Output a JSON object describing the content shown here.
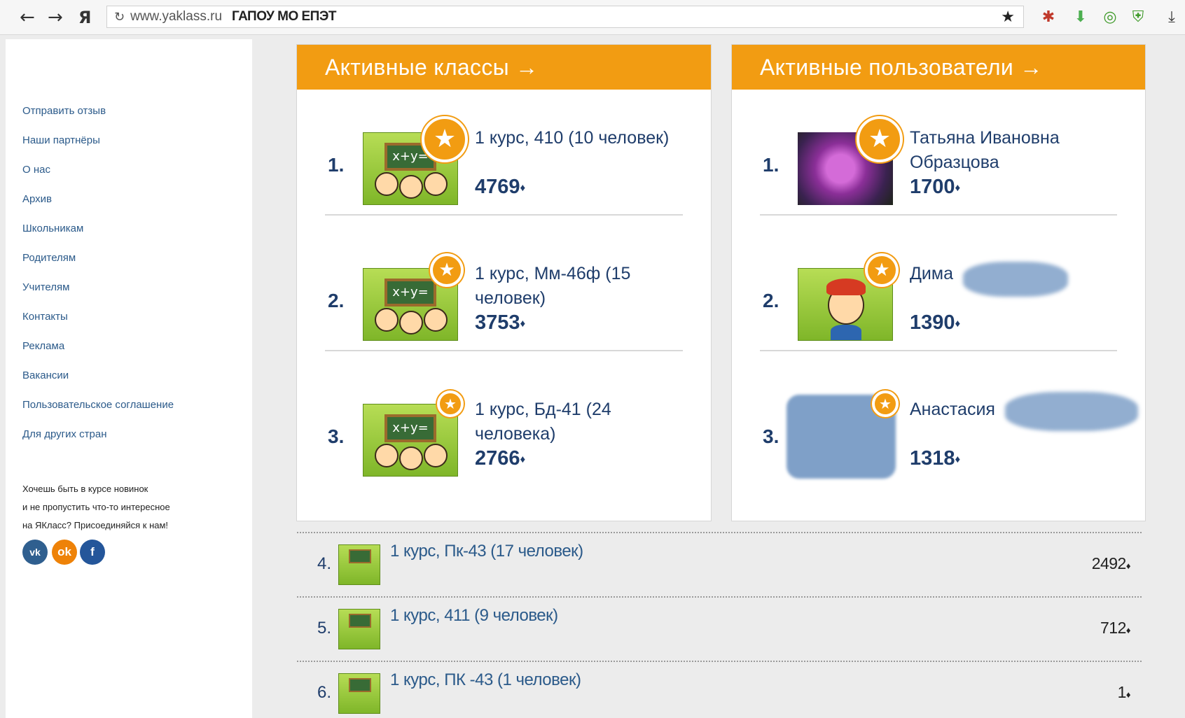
{
  "browser": {
    "back": "←",
    "forward": "→",
    "home": "Я",
    "url": "www.yaklass.ru",
    "page_title": "ГАПОУ МО ЕПЭТ"
  },
  "sidebar": {
    "links": [
      "Отправить отзыв",
      "Наши партнёры",
      "О нас",
      "Архив",
      "Школьникам",
      "Родителям",
      "Учителям",
      "Контакты",
      "Реклама",
      "Вакансии",
      "Пользовательское соглашение",
      "Для других стран"
    ],
    "promo": [
      "Хочешь быть в курсе новинок",
      "и не пропустить что-то интересное",
      "на ЯКласс? Присоединяйся к нам!"
    ],
    "social": [
      "vk",
      "ok",
      "f"
    ]
  },
  "classes_panel": {
    "title": "Активные классы →",
    "board_text": "x+y=",
    "entries": [
      {
        "rank": "1.",
        "name": "1 курс, 410 (10 человек)",
        "score": "4769"
      },
      {
        "rank": "2.",
        "name": "1 курс, Мм-46ф (15 человек)",
        "score": "3753"
      },
      {
        "rank": "3.",
        "name": "1 курс, Бд-41 (24 человека)",
        "score": "2766"
      }
    ]
  },
  "users_panel": {
    "title": "Активные пользователи →",
    "entries": [
      {
        "rank": "1.",
        "name": "Татьяна Ивановна Образцова",
        "score": "1700"
      },
      {
        "rank": "2.",
        "name": "Дима",
        "score": "1390"
      },
      {
        "rank": "3.",
        "name": "Анастасия",
        "score": "1318"
      }
    ]
  },
  "more_classes": [
    {
      "rank": "4.",
      "name": "1 курс, Пк-43 (17 человек)",
      "score": "2492"
    },
    {
      "rank": "5.",
      "name": "1 курс, 411 (9 человек)",
      "score": "712"
    },
    {
      "rank": "6.",
      "name": "1 курс, ПК -43 (1 человек)",
      "score": "1"
    }
  ],
  "score_symbol": "♦",
  "colors": {
    "accent": "#f29c12",
    "link": "#2b5a8a",
    "text": "#1f3d6b"
  }
}
